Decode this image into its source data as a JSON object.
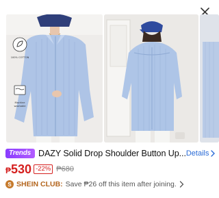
{
  "header": {
    "close_icon": "close-icon"
  },
  "gallery": {
    "images": [
      {
        "semantic": "model-front-blue-shirt-photo"
      },
      {
        "semantic": "model-back-blue-shirt-photo"
      },
      {
        "semantic": "partial-next-photo"
      }
    ],
    "badges": [
      {
        "icon": "leaf-icon",
        "text": "100% COTTON"
      },
      {
        "icon": "wash-icon",
        "text": "Machine washable"
      }
    ]
  },
  "product": {
    "tag": "Trends",
    "title": "DAZY Solid Drop Shoulder Button Up...",
    "details_label": "Details",
    "price_currency": "₱",
    "price": "530",
    "discount": "-22%",
    "original_price": "₱680"
  },
  "club": {
    "icon_letter": "S",
    "label": "SHEIN CLUB:",
    "text": "Save ₱26 off this item after joining."
  },
  "colors": {
    "accent": "#d5201f",
    "link": "#2a6bd6",
    "trends": "#9b4dff",
    "club": "#b3651d"
  }
}
